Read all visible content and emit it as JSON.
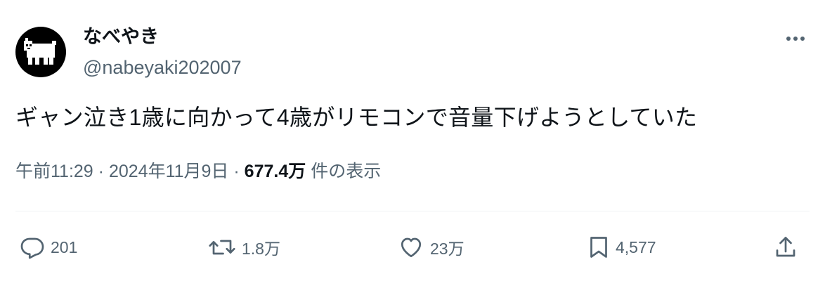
{
  "author": {
    "display_name": "なべやき",
    "handle": "@nabeyaki202007",
    "avatar_icon": "pixel-dog-avatar-icon"
  },
  "tweet": {
    "text": "ギャン泣き1歳に向かって4歳がリモコンで音量下げようとしていた"
  },
  "meta": {
    "time": "午前11:29",
    "separator": "·",
    "date": "2024年11月9日",
    "views_count": "677.4万",
    "views_label": "件の表示"
  },
  "actions": {
    "reply_count": "201",
    "retweet_count": "1.8万",
    "like_count": "23万",
    "bookmark_count": "4,577"
  },
  "colors": {
    "text": "#0f1419",
    "secondary": "#536471",
    "divider": "#eff3f4"
  }
}
